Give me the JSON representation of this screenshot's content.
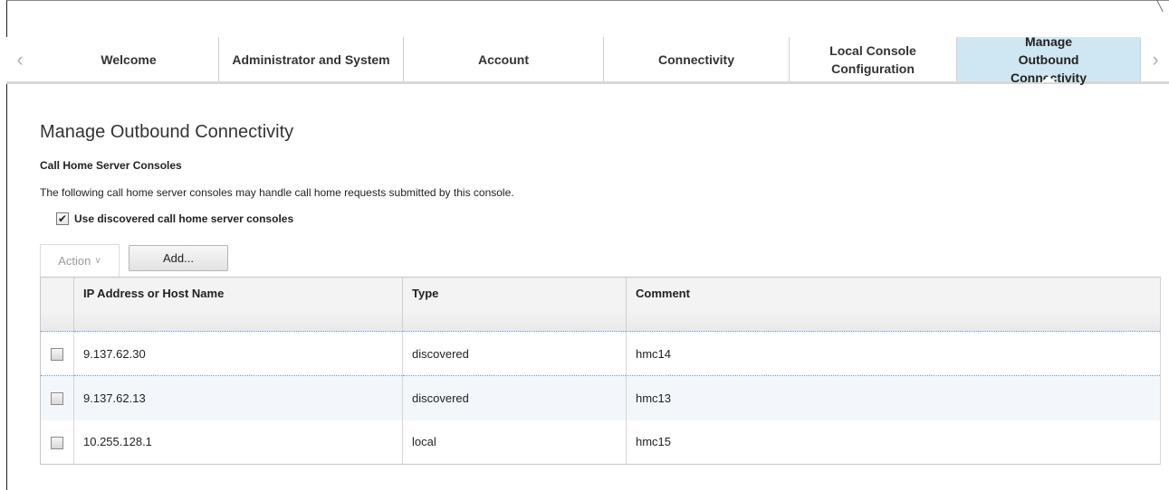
{
  "tabs": [
    {
      "label": "Welcome"
    },
    {
      "label": "Administrator and System"
    },
    {
      "label": "Account"
    },
    {
      "label": "Connectivity"
    },
    {
      "label": "Local Console Configuration"
    },
    {
      "label": "Manage Outbound Connectivity",
      "active": true
    }
  ],
  "page": {
    "title": "Manage Outbound Connectivity",
    "section_title": "Call Home Server Consoles",
    "description": "The following call home server consoles may handle call home requests submitted by this console.",
    "use_discovered_label": "Use discovered call home server consoles",
    "use_discovered_checked": true
  },
  "toolbar": {
    "action_label": "Action",
    "add_label": "Add..."
  },
  "table": {
    "columns": [
      "IP Address or Host Name",
      "Type",
      "Comment"
    ],
    "rows": [
      {
        "address": "9.137.62.30",
        "type": "discovered",
        "comment": "hmc14",
        "checked": false
      },
      {
        "address": "9.137.62.13",
        "type": "discovered",
        "comment": "hmc13",
        "checked": false
      },
      {
        "address": "10.255.128.1",
        "type": "local",
        "comment": "hmc15",
        "checked": false
      }
    ]
  },
  "icons": {
    "tab_scroll_left": "chevron-left-icon",
    "tab_scroll_right": "chevron-right-icon",
    "action_dropdown": "chevron-down-icon",
    "checkmark": "checkmark-icon"
  },
  "colors": {
    "active_tab_bg": "#cfe7f2",
    "row_highlight": "#f3f7fb",
    "row_separator": "#6d9ad1"
  }
}
